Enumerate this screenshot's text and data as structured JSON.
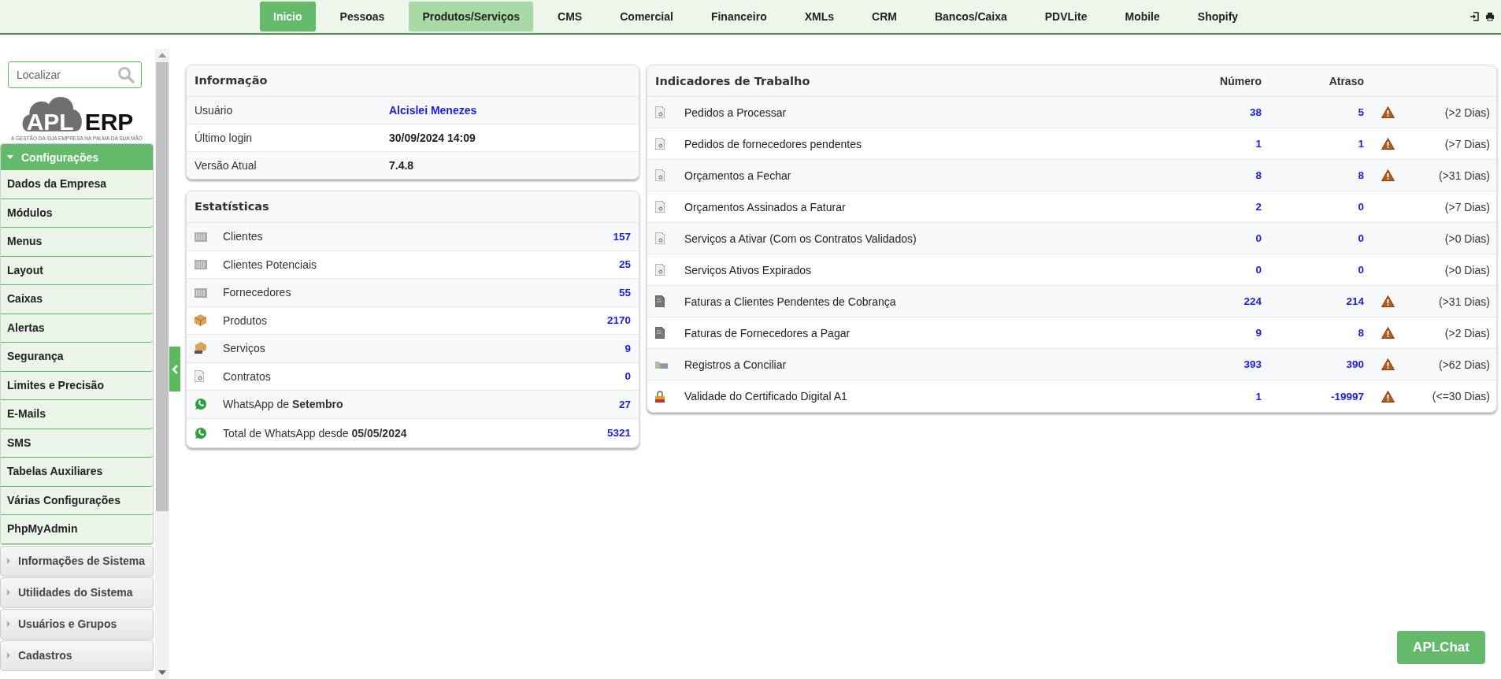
{
  "top_nav": {
    "tabs": [
      {
        "label": "Inicio",
        "selected": true,
        "hovered": false
      },
      {
        "label": "Pessoas",
        "selected": false,
        "hovered": false
      },
      {
        "label": "Produtos/Serviços",
        "selected": false,
        "hovered": true
      },
      {
        "label": "CMS",
        "selected": false,
        "hovered": false
      },
      {
        "label": "Comercial",
        "selected": false,
        "hovered": false
      },
      {
        "label": "Financeiro",
        "selected": false,
        "hovered": false
      },
      {
        "label": "XMLs",
        "selected": false,
        "hovered": false
      },
      {
        "label": "CRM",
        "selected": false,
        "hovered": false
      },
      {
        "label": "Bancos/Caixa",
        "selected": false,
        "hovered": false
      },
      {
        "label": "PDVLite",
        "selected": false,
        "hovered": false
      },
      {
        "label": "Mobile",
        "selected": false,
        "hovered": false
      },
      {
        "label": "Shopify",
        "selected": false,
        "hovered": false
      }
    ]
  },
  "sidebar": {
    "search": {
      "placeholder": "Localizar"
    },
    "logo": {
      "left": "APL",
      "right": "ERP",
      "tagline": "A GESTÃO DA SUA EMPRESA NA PALMA DA SUA MÃO"
    },
    "groups": [
      {
        "label": "Configurações",
        "expanded": true,
        "items": [
          "Dados da Empresa",
          "Módulos",
          "Menus",
          "Layout",
          "Caixas",
          "Alertas",
          "Segurança",
          "Limites e Precisão",
          "E-Mails",
          "SMS",
          "Tabelas Auxiliares",
          "Várias Configurações",
          "PhpMyAdmin"
        ]
      },
      {
        "label": "Informações de Sistema",
        "expanded": false
      },
      {
        "label": "Utilidades do Sistema",
        "expanded": false
      },
      {
        "label": "Usuários e Grupos",
        "expanded": false
      },
      {
        "label": "Cadastros",
        "expanded": false
      }
    ]
  },
  "info_panel": {
    "title": "Informação",
    "rows": [
      {
        "label": "Usuário",
        "value": "Alcislei Menezes",
        "kind": "link"
      },
      {
        "label": "Último login",
        "value": "30/09/2024 14:09",
        "kind": "text"
      },
      {
        "label": "Versão Atual",
        "value": "7.4.8",
        "kind": "text"
      }
    ]
  },
  "stats_panel": {
    "title": "Estatísticas",
    "rows": [
      {
        "kind": "building",
        "label": "Clientes",
        "value": "157"
      },
      {
        "kind": "building",
        "label": "Clientes Potenciais",
        "value": "25"
      },
      {
        "kind": "building",
        "label": "Fornecedores",
        "value": "55"
      },
      {
        "kind": "box",
        "label": "Produtos",
        "value": "2170"
      },
      {
        "kind": "service",
        "label": "Serviços",
        "value": "9"
      },
      {
        "kind": "document",
        "label": "Contratos",
        "value": "0"
      },
      {
        "kind": "chat",
        "label": "WhatsApp de **Setembro**",
        "value": "27"
      },
      {
        "kind": "chat",
        "label": "Total de WhatsApp desde **05/05/2024**",
        "value": "5321"
      }
    ]
  },
  "indicators_panel": {
    "title": "Indicadores de Trabalho",
    "columns": [
      "Número",
      "Atraso"
    ],
    "rows": [
      {
        "kind": "document",
        "label": "Pedidos a Processar",
        "number": "38",
        "delay": "5",
        "warning": true,
        "threshold": "(>2 Dias)"
      },
      {
        "kind": "document",
        "label": "Pedidos de fornecedores pendentes",
        "number": "1",
        "delay": "1",
        "warning": true,
        "threshold": "(>7 Dias)"
      },
      {
        "kind": "document",
        "label": "Orçamentos a Fechar",
        "number": "8",
        "delay": "8",
        "warning": true,
        "threshold": "(>31 Dias)"
      },
      {
        "kind": "document",
        "label": "Orçamentos Assinados a Faturar",
        "number": "2",
        "delay": "0",
        "warning": false,
        "threshold": "(>7 Dias)"
      },
      {
        "kind": "document",
        "label": "Serviços a Ativar (Com os Contratos Validados)",
        "number": "0",
        "delay": "0",
        "warning": false,
        "threshold": "(>0 Dias)"
      },
      {
        "kind": "document",
        "label": "Serviços Ativos Expirados",
        "number": "0",
        "delay": "0",
        "warning": false,
        "threshold": "(>0 Dias)"
      },
      {
        "kind": "invoice",
        "label": "Faturas a Clientes Pendentes de Cobrança",
        "number": "224",
        "delay": "214",
        "warning": true,
        "threshold": "(>31 Dias)"
      },
      {
        "kind": "invoice",
        "label": "Faturas de Fornecedores a Pagar",
        "number": "9",
        "delay": "8",
        "warning": true,
        "threshold": "(>2 Dias)"
      },
      {
        "kind": "bank",
        "label": "Registros a Conciliar",
        "number": "393",
        "delay": "390",
        "warning": true,
        "threshold": "(>62 Dias)"
      },
      {
        "kind": "lock",
        "label": "Validade do Certificado Digital A1",
        "number": "1",
        "delay": "-19997",
        "warning": true,
        "threshold": "(<=30 Dias)"
      }
    ]
  },
  "chat_button": {
    "label": "APLChat"
  }
}
